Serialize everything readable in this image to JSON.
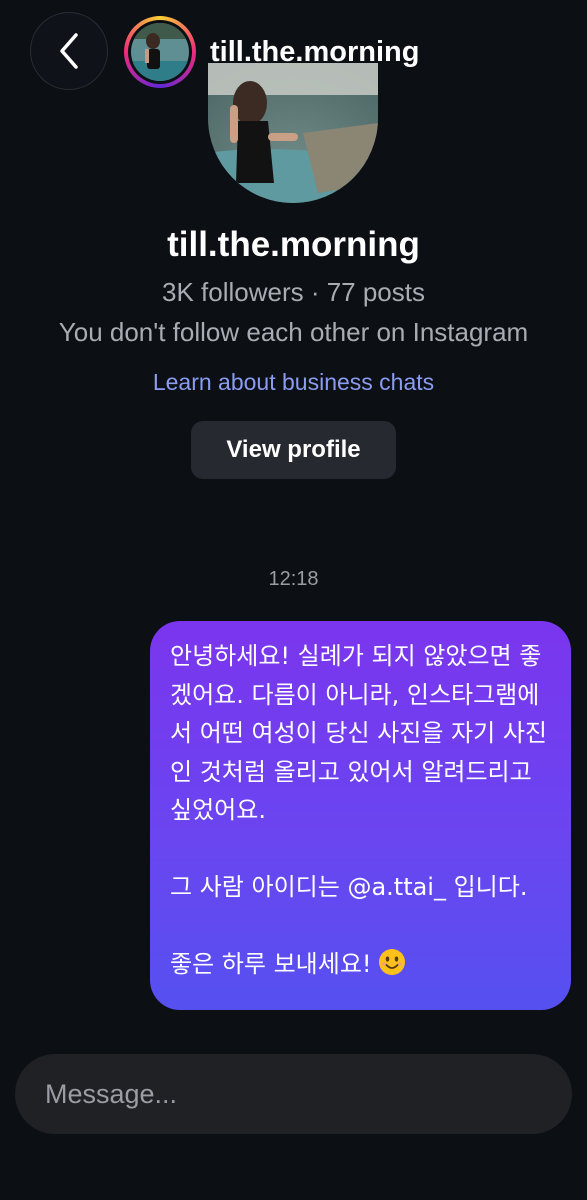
{
  "header": {
    "username": "till.the.morning",
    "back_icon": "chevron-left-icon"
  },
  "profile": {
    "name": "till.the.morning",
    "stats": "3K followers · 77 posts",
    "relation": "You don't follow each other on Instagram",
    "business_link": "Learn about business chats",
    "view_profile_label": "View profile"
  },
  "thread": {
    "timestamp": "12:18",
    "message": {
      "paragraph_1": "안녕하세요! 실례가 되지 않았으면 좋겠어요. 다름이 아니라, 인스타그램에서 어떤 여성이 당신 사진을 자기 사진인 것처럼 올리고 있어서 알려드리고 싶었어요.",
      "paragraph_2": "그 사람 아이디는 @a.ttai_ 입니다.",
      "paragraph_3": "좋은 하루 보내세요!",
      "emoji": "smiling-face-emoji"
    }
  },
  "composer": {
    "placeholder": "Message..."
  },
  "colors": {
    "background": "#0c0f14",
    "bubble_top": "#7b35ee",
    "bubble_bottom": "#5650f0",
    "link": "#8b9cf0",
    "secondary_text": "#a9acb2"
  }
}
